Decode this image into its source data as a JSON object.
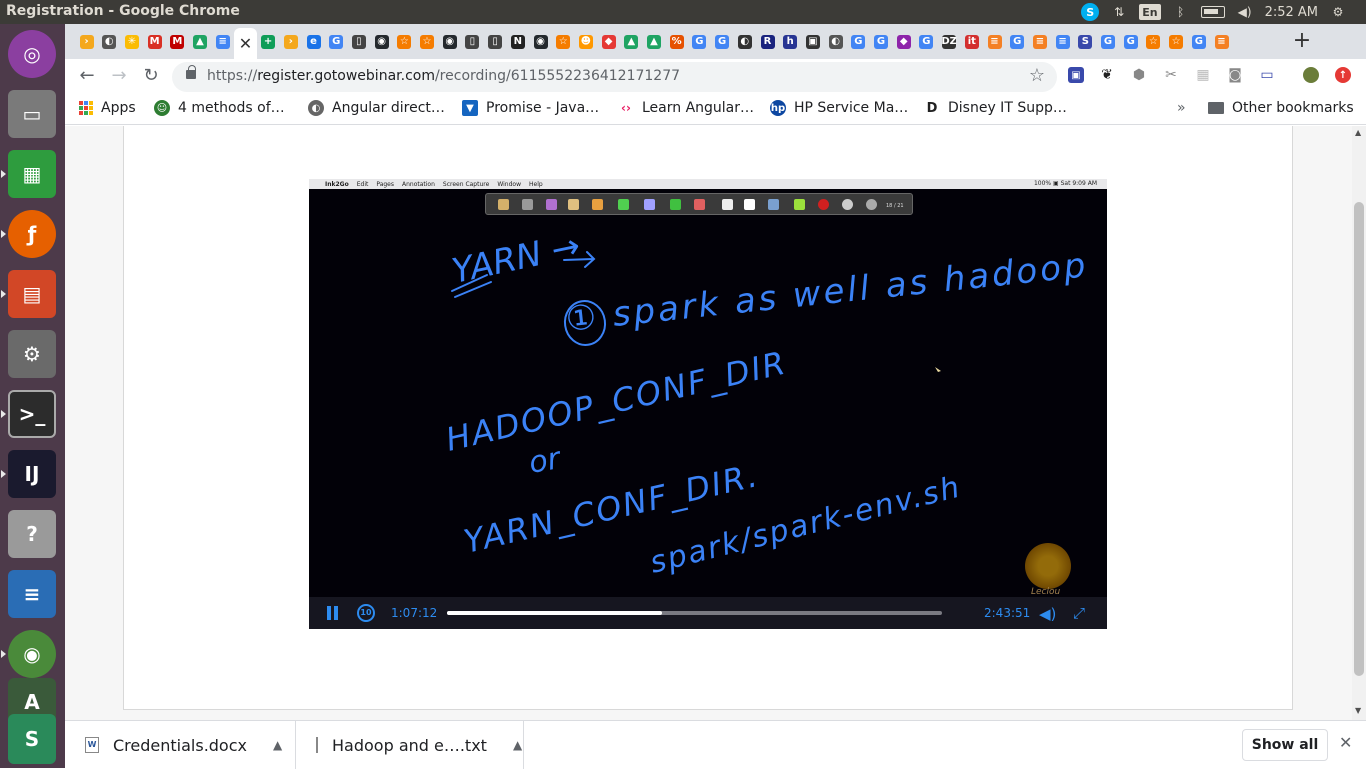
{
  "window": {
    "title": "Registration - Google Chrome"
  },
  "system_tray": {
    "keyboard": "En",
    "time": "2:52 AM"
  },
  "tabs": [
    {
      "icon": "generic-favicon",
      "color": "#f4a81d",
      "text": "›"
    },
    {
      "icon": "chromium-favicon",
      "color": "#555555",
      "text": "◐"
    },
    {
      "icon": "walmart-favicon",
      "color": "#fbbc04",
      "text": "✳"
    },
    {
      "icon": "gmail-favicon",
      "color": "#d93025",
      "text": "M"
    },
    {
      "icon": "mcafee-favicon",
      "color": "#c00000",
      "text": "M"
    },
    {
      "icon": "drive-favicon",
      "color": "#1fa463",
      "text": "▲"
    },
    {
      "icon": "docs-favicon",
      "color": "#4285f4",
      "text": "≡"
    },
    {
      "icon": "close-tab",
      "color": "#ffffff",
      "text": "✕"
    },
    {
      "icon": "sheets-favicon",
      "color": "#0f9d58",
      "text": "+"
    },
    {
      "icon": "generic-favicon",
      "color": "#f4a81d",
      "text": "›"
    },
    {
      "icon": "eclipse-favicon",
      "color": "#1a73e8",
      "text": "e"
    },
    {
      "icon": "google-favicon",
      "color": "#4285f4",
      "text": "G"
    },
    {
      "icon": "book-favicon",
      "color": "#444444",
      "text": "▯"
    },
    {
      "icon": "github-favicon",
      "color": "#24292e",
      "text": "◉"
    },
    {
      "icon": "star-favicon",
      "color": "#f57c00",
      "text": "☆"
    },
    {
      "icon": "star-favicon",
      "color": "#f57c00",
      "text": "☆"
    },
    {
      "icon": "github-favicon",
      "color": "#24292e",
      "text": "◉"
    },
    {
      "icon": "book-favicon",
      "color": "#444444",
      "text": "▯"
    },
    {
      "icon": "book-favicon",
      "color": "#444444",
      "text": "▯"
    },
    {
      "icon": "medium-favicon",
      "color": "#222222",
      "text": "N"
    },
    {
      "icon": "github-favicon",
      "color": "#24292e",
      "text": "◉"
    },
    {
      "icon": "star-favicon",
      "color": "#f57c00",
      "text": "☆"
    },
    {
      "icon": "emoji-favicon",
      "color": "#ff9800",
      "text": "☻"
    },
    {
      "icon": "stack-favicon",
      "color": "#e53935",
      "text": "◆"
    },
    {
      "icon": "drive-favicon",
      "color": "#1fa463",
      "text": "▲"
    },
    {
      "icon": "drive-favicon",
      "color": "#1fa463",
      "text": "▲"
    },
    {
      "icon": "percent-favicon",
      "color": "#e65100",
      "text": "%"
    },
    {
      "icon": "google-favicon",
      "color": "#4285f4",
      "text": "G"
    },
    {
      "icon": "google-favicon",
      "color": "#4285f4",
      "text": "G"
    },
    {
      "icon": "ghost-favicon",
      "color": "#333333",
      "text": "◐"
    },
    {
      "icon": "r-favicon",
      "color": "#1a237e",
      "text": "R"
    },
    {
      "icon": "h-favicon",
      "color": "#283593",
      "text": "h"
    },
    {
      "icon": "image-favicon",
      "color": "#333333",
      "text": "▣"
    },
    {
      "icon": "chromium-favicon",
      "color": "#555555",
      "text": "◐"
    },
    {
      "icon": "google-favicon",
      "color": "#4285f4",
      "text": "G"
    },
    {
      "icon": "google-favicon",
      "color": "#4285f4",
      "text": "G"
    },
    {
      "icon": "cube-favicon",
      "color": "#8e24aa",
      "text": "◆"
    },
    {
      "icon": "google-favicon",
      "color": "#4285f4",
      "text": "G"
    },
    {
      "icon": "dzone-favicon",
      "color": "#333333",
      "text": "DZ"
    },
    {
      "icon": "it-favicon",
      "color": "#d32f2f",
      "text": "it"
    },
    {
      "icon": "stackoverflow-favicon",
      "color": "#f48024",
      "text": "≡"
    },
    {
      "icon": "google-favicon",
      "color": "#4285f4",
      "text": "G"
    },
    {
      "icon": "stackoverflow-favicon",
      "color": "#f48024",
      "text": "≡"
    },
    {
      "icon": "docs-favicon",
      "color": "#4285f4",
      "text": "≡"
    },
    {
      "icon": "s-favicon",
      "color": "#3949ab",
      "text": "S"
    },
    {
      "icon": "google-favicon",
      "color": "#4285f4",
      "text": "G"
    },
    {
      "icon": "google-favicon",
      "color": "#4285f4",
      "text": "G"
    },
    {
      "icon": "star-favicon",
      "color": "#f57c00",
      "text": "☆"
    },
    {
      "icon": "star-favicon",
      "color": "#f57c00",
      "text": "☆"
    },
    {
      "icon": "google-favicon",
      "color": "#4285f4",
      "text": "G"
    },
    {
      "icon": "stackoverflow-favicon",
      "color": "#f48024",
      "text": "≡"
    }
  ],
  "address": {
    "prefix": "https://",
    "domain": "register.gotowebinar.com",
    "path": "/recording/6115552236412171277"
  },
  "bookmarks": {
    "apps": "Apps",
    "items": [
      "4 methods of…",
      "Angular direct…",
      "Promise - Java…",
      "Learn Angular…",
      "HP Service Ma…",
      "Disney IT Supp…"
    ],
    "more": "»",
    "other": "Other bookmarks"
  },
  "player": {
    "current_time": "1:07:12",
    "duration": "2:43:51",
    "progress": 0.435,
    "rewind_label": "10",
    "mac_menu": [
      "Ink2Go",
      "Edit",
      "Pages",
      "Annotation",
      "Screen Capture",
      "Window",
      "Help"
    ],
    "mac_menu_right": "100% ▣  Sat 9:09 AM",
    "page_counter": "18 / 21",
    "seal_label": "Leclou"
  },
  "whiteboard_text": {
    "line1": "YARN →",
    "line2": "① spark as well as hadoop",
    "line3": "HADOOP_CONF_DIR",
    "line4": "or",
    "line5": "YARN_CONF_DIR.",
    "line6": "spark/spark-env.sh"
  },
  "downloads": [
    {
      "name": "Credentials.docx",
      "icon": "word-doc-icon"
    },
    {
      "name": "Hadoop and e….txt",
      "icon": "text-file-icon"
    }
  ],
  "download_bar": {
    "show_all": "Show all"
  }
}
